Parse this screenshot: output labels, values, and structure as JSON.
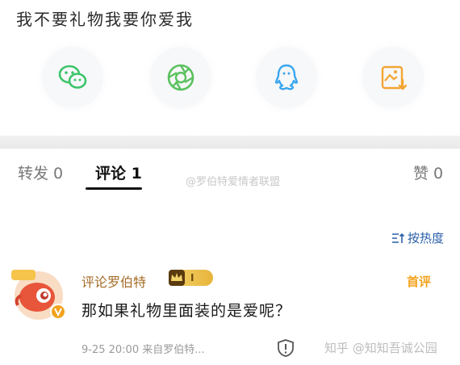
{
  "post": {
    "title": "我不要礼物我要你爱我"
  },
  "share": {
    "items": [
      {
        "name": "wechat",
        "icon": "wechat-icon",
        "color": "#3cc46a"
      },
      {
        "name": "moments",
        "icon": "moments-icon",
        "color": "#5bc15f"
      },
      {
        "name": "qq",
        "icon": "qq-icon",
        "color": "#3aa6ee"
      },
      {
        "name": "save-image",
        "icon": "save-image-icon",
        "color": "#f2a533"
      }
    ]
  },
  "tabs": {
    "repost": "转发 0",
    "comments": "评论 1",
    "likes": "赞 0"
  },
  "watermarks": {
    "weibo": "@罗伯特爱情者联盟",
    "zhihu": "知乎 @知知吾诚公园"
  },
  "sort": {
    "label": "按热度"
  },
  "comment": {
    "author": "评论罗伯特",
    "rank": "I",
    "first_badge": "首评",
    "text": "那如果礼物里面装的是爱呢？",
    "meta": "9-25 20:00  来自罗伯特..."
  },
  "colors": {
    "accent_blue": "#2a5fa8",
    "author": "#a46a26",
    "first_badge": "#f4a21b"
  }
}
